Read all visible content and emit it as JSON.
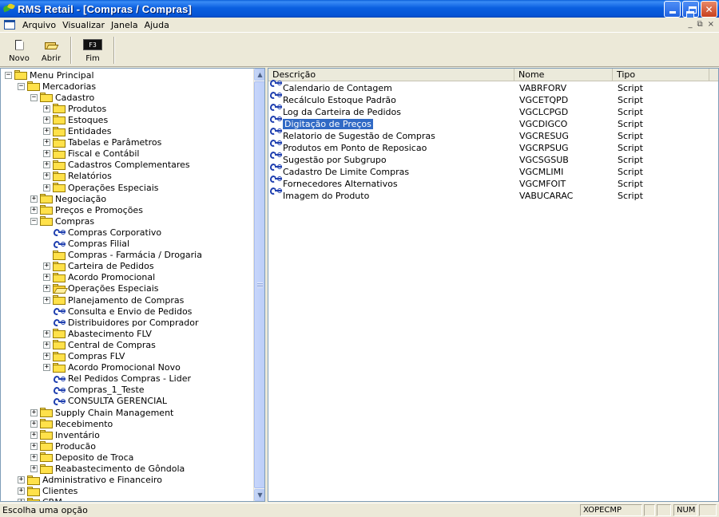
{
  "window": {
    "title": "RMS Retail - [Compras / Compras]",
    "mdi_controls": [
      "_",
      "×"
    ]
  },
  "menubar": {
    "items": [
      {
        "label": "Arquivo"
      },
      {
        "label": "Visualizar"
      },
      {
        "label": "Janela"
      },
      {
        "label": "Ajuda"
      }
    ]
  },
  "toolbar": {
    "new_label": "Novo",
    "open_label": "Abrir",
    "exit_label": "Fim",
    "exit_key": "F3"
  },
  "tree": {
    "items": [
      {
        "label": "Menu Principal",
        "level": 0,
        "expander": "−",
        "icon": "folder"
      },
      {
        "label": "Mercadorias",
        "level": 1,
        "expander": "−",
        "icon": "folder"
      },
      {
        "label": "Cadastro",
        "level": 2,
        "expander": "−",
        "icon": "folder"
      },
      {
        "label": "Produtos",
        "level": 3,
        "expander": "+",
        "icon": "folder"
      },
      {
        "label": "Estoques",
        "level": 3,
        "expander": "+",
        "icon": "folder"
      },
      {
        "label": "Entidades",
        "level": 3,
        "expander": "+",
        "icon": "folder"
      },
      {
        "label": "Tabelas e Parâmetros",
        "level": 3,
        "expander": "+",
        "icon": "folder"
      },
      {
        "label": "Fiscal e Contábil",
        "level": 3,
        "expander": "+",
        "icon": "folder"
      },
      {
        "label": "Cadastros Complementares",
        "level": 3,
        "expander": "+",
        "icon": "folder"
      },
      {
        "label": "Relatórios",
        "level": 3,
        "expander": "+",
        "icon": "folder"
      },
      {
        "label": "Operações Especiais",
        "level": 3,
        "expander": "+",
        "icon": "folder"
      },
      {
        "label": "Negociação",
        "level": 2,
        "expander": "+",
        "icon": "folder"
      },
      {
        "label": "Preços e Promoções",
        "level": 2,
        "expander": "+",
        "icon": "folder"
      },
      {
        "label": "Compras",
        "level": 2,
        "expander": "−",
        "icon": "folder"
      },
      {
        "label": "Compras Corporativo",
        "level": 3,
        "expander": "",
        "icon": "program"
      },
      {
        "label": "Compras Filial",
        "level": 3,
        "expander": "",
        "icon": "program"
      },
      {
        "label": "Compras - Farmácia / Drogaria",
        "level": 3,
        "expander": "",
        "icon": "folder"
      },
      {
        "label": "Carteira de Pedidos",
        "level": 3,
        "expander": "+",
        "icon": "folder"
      },
      {
        "label": "Acordo Promocional",
        "level": 3,
        "expander": "+",
        "icon": "folder"
      },
      {
        "label": "Operações Especiais",
        "level": 3,
        "expander": "+",
        "icon": "folder-open"
      },
      {
        "label": "Planejamento de Compras",
        "level": 3,
        "expander": "+",
        "icon": "folder"
      },
      {
        "label": "Consulta e Envio de Pedidos",
        "level": 3,
        "expander": "",
        "icon": "program"
      },
      {
        "label": "Distribuidores por Comprador",
        "level": 3,
        "expander": "",
        "icon": "program"
      },
      {
        "label": "Abastecimento FLV",
        "level": 3,
        "expander": "+",
        "icon": "folder"
      },
      {
        "label": "Central de Compras",
        "level": 3,
        "expander": "+",
        "icon": "folder"
      },
      {
        "label": "Compras FLV",
        "level": 3,
        "expander": "+",
        "icon": "folder"
      },
      {
        "label": "Acordo Promocional Novo",
        "level": 3,
        "expander": "+",
        "icon": "folder"
      },
      {
        "label": "Rel Pedidos Compras - Lider",
        "level": 3,
        "expander": "",
        "icon": "program"
      },
      {
        "label": "Compras_1_Teste",
        "level": 3,
        "expander": "",
        "icon": "program"
      },
      {
        "label": "CONSULTA GERENCIAL",
        "level": 3,
        "expander": "",
        "icon": "program"
      },
      {
        "label": "Supply Chain Management",
        "level": 2,
        "expander": "+",
        "icon": "folder"
      },
      {
        "label": "Recebimento",
        "level": 2,
        "expander": "+",
        "icon": "folder"
      },
      {
        "label": "Inventário",
        "level": 2,
        "expander": "+",
        "icon": "folder"
      },
      {
        "label": "Producão",
        "level": 2,
        "expander": "+",
        "icon": "folder"
      },
      {
        "label": "Deposito de Troca",
        "level": 2,
        "expander": "+",
        "icon": "folder"
      },
      {
        "label": "Reabastecimento de Gôndola",
        "level": 2,
        "expander": "+",
        "icon": "folder"
      },
      {
        "label": "Administrativo e Financeiro",
        "level": 1,
        "expander": "+",
        "icon": "folder"
      },
      {
        "label": "Clientes",
        "level": 1,
        "expander": "+",
        "icon": "folder"
      },
      {
        "label": "CRM",
        "level": 1,
        "expander": "+",
        "icon": "folder"
      }
    ]
  },
  "list": {
    "columns": [
      "Descrição",
      "Nome",
      "Tipo"
    ],
    "rows": [
      {
        "descricao": "Calendario de Contagem",
        "nome": "VABRFORV",
        "tipo": "Script",
        "selected": false
      },
      {
        "descricao": "Recálculo Estoque Padrão",
        "nome": "VGCETQPD",
        "tipo": "Script",
        "selected": false
      },
      {
        "descricao": "Log da Carteira de Pedidos",
        "nome": "VGCLCPGD",
        "tipo": "Script",
        "selected": false
      },
      {
        "descricao": "Digitação de Preços",
        "nome": "VGCDIGCO",
        "tipo": "Script",
        "selected": true
      },
      {
        "descricao": "Relatorio de Sugestão de Compras",
        "nome": "VGCRESUG",
        "tipo": "Script",
        "selected": false
      },
      {
        "descricao": "Produtos em Ponto de Reposicao",
        "nome": "VGCRPSUG",
        "tipo": "Script",
        "selected": false
      },
      {
        "descricao": "Sugestão por Subgrupo",
        "nome": "VGCSGSUB",
        "tipo": "Script",
        "selected": false
      },
      {
        "descricao": "Cadastro De Limite Compras",
        "nome": "VGCMLIMI",
        "tipo": "Script",
        "selected": false
      },
      {
        "descricao": "Fornecedores Alternativos",
        "nome": "VGCMFOIT",
        "tipo": "Script",
        "selected": false
      },
      {
        "descricao": "Imagem do Produto",
        "nome": "VABUCARAC",
        "tipo": "Script",
        "selected": false
      }
    ]
  },
  "status": {
    "message": "Escolha uma opção",
    "user": "XOPECMP",
    "num": "NUM"
  },
  "colors": {
    "selection": "#316ac5",
    "titlebar": "#0a5fd8"
  }
}
